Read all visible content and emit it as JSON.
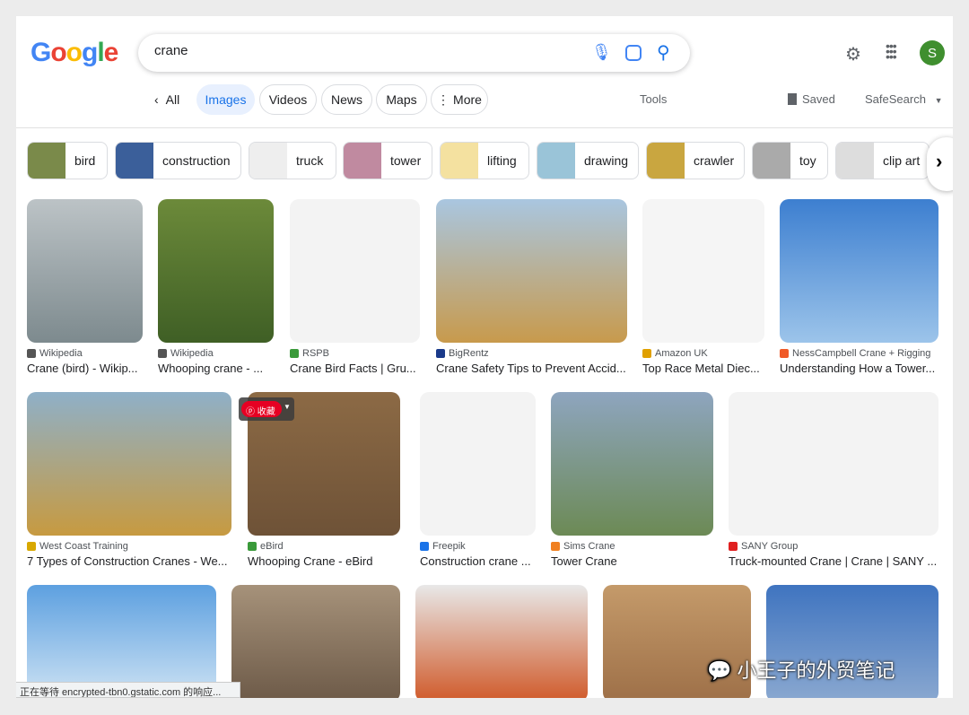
{
  "logo": "Google",
  "search": {
    "query": "crane"
  },
  "header": {
    "avatar_letter": "S",
    "colors": {
      "accent": "#1a73e8",
      "avatar": "#3f8f2f"
    }
  },
  "tabs": [
    {
      "label": "All"
    },
    {
      "label": "Images"
    },
    {
      "label": "Videos"
    },
    {
      "label": "News"
    },
    {
      "label": "Maps"
    },
    {
      "label": "More"
    }
  ],
  "tools": "Tools",
  "saved": "Saved",
  "safesearch": "SafeSearch",
  "chips": [
    {
      "label": "bird"
    },
    {
      "label": "construction"
    },
    {
      "label": "truck"
    },
    {
      "label": "tower"
    },
    {
      "label": "lifting"
    },
    {
      "label": "drawing"
    },
    {
      "label": "crawler"
    },
    {
      "label": "toy"
    },
    {
      "label": "clip art"
    }
  ],
  "results": [
    {
      "source": "Wikipedia",
      "title": "Crane (bird) - Wikip..."
    },
    {
      "source": "Wikipedia",
      "title": "Whooping crane - ..."
    },
    {
      "source": "RSPB",
      "title": "Crane Bird Facts | Gru..."
    },
    {
      "source": "BigRentz",
      "title": "Crane Safety Tips to Prevent Accid..."
    },
    {
      "source": "Amazon UK",
      "title": "Top Race Metal Diec..."
    },
    {
      "source": "NessCampbell Crane + Rigging",
      "title": "Understanding How a Tower..."
    },
    {
      "source": "West Coast Training",
      "title": "7 Types of Construction Cranes - We..."
    },
    {
      "source": "eBird",
      "title": "Whooping Crane - eBird"
    },
    {
      "source": "Freepik",
      "title": "Construction crane ..."
    },
    {
      "source": "Sims Crane",
      "title": "Tower Crane"
    },
    {
      "source": "SANY Group",
      "title": "Truck-mounted Crane | Crane | SANY ..."
    }
  ],
  "pin_button": "收藏",
  "status_bar": "正在等待 encrypted-tbn0.gstatic.com 的响应...",
  "watermark": "小王子的外贸笔记"
}
